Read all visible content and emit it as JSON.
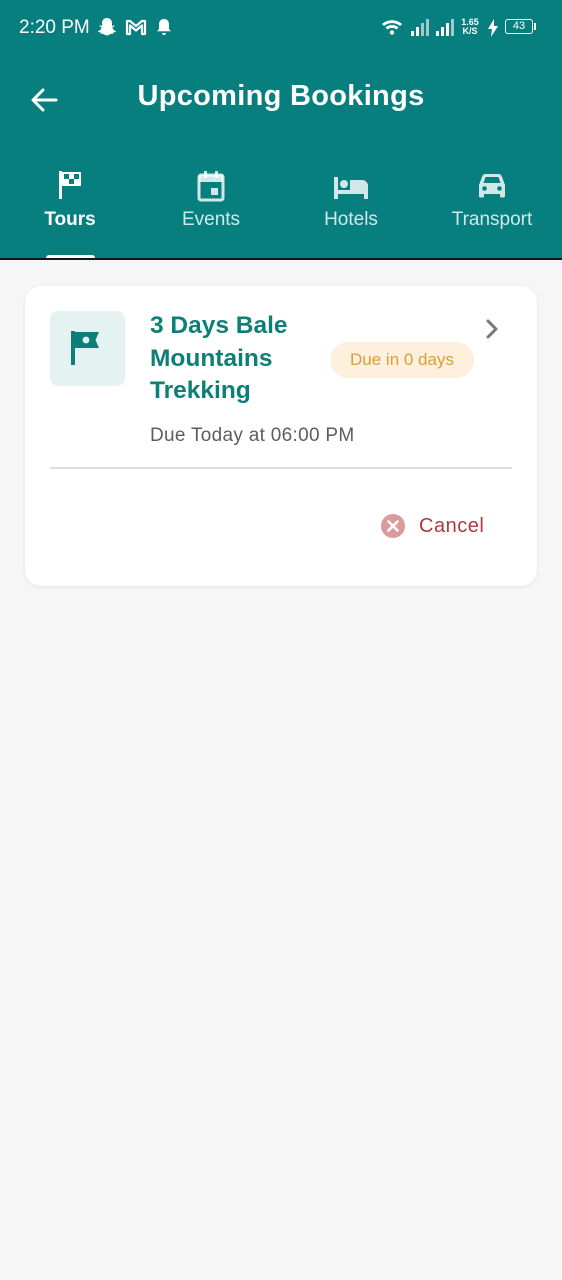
{
  "status_bar": {
    "time": "2:20 PM",
    "network_speed_value": "1.65",
    "network_speed_unit": "K/S",
    "battery": "43"
  },
  "header": {
    "title": "Upcoming Bookings",
    "back_icon": "arrow-back-icon"
  },
  "tabs": [
    {
      "label": "Tours",
      "icon": "flag-icon",
      "active": true
    },
    {
      "label": "Events",
      "icon": "calendar-icon",
      "active": false
    },
    {
      "label": "Hotels",
      "icon": "bed-icon",
      "active": false
    },
    {
      "label": "Transport",
      "icon": "car-icon",
      "active": false
    }
  ],
  "booking": {
    "title": "3 Days Bale Mountains Trekking",
    "badge": "Due in 0 days",
    "due_text": "Due Today at 06:00 PM",
    "cancel_label": "Cancel"
  },
  "colors": {
    "primary": "#077f7e",
    "title_text": "#0e7f78",
    "badge_bg": "#fdf0dd",
    "badge_text": "#dd9e32",
    "cancel_text": "#b03a3a",
    "background": "#f6f6f6"
  }
}
